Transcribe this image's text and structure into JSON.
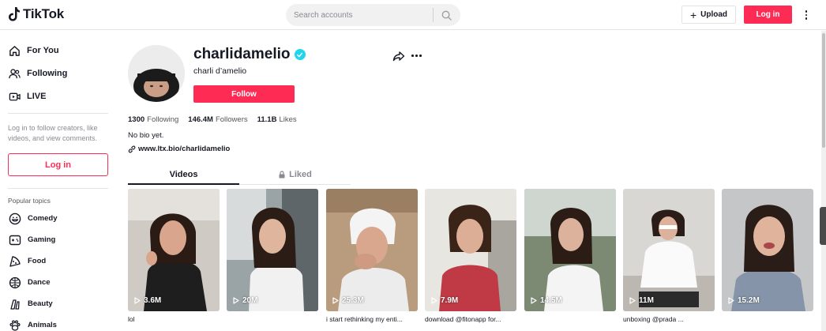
{
  "header": {
    "logo_text": "TikTok",
    "search_placeholder": "Search accounts",
    "upload_label": "Upload",
    "login_label": "Log in"
  },
  "sidebar": {
    "nav": [
      {
        "label": "For You",
        "icon": "home-icon"
      },
      {
        "label": "Following",
        "icon": "following-icon"
      },
      {
        "label": "LIVE",
        "icon": "live-icon"
      }
    ],
    "login_hint": "Log in to follow creators, like videos, and view comments.",
    "login_label": "Log in",
    "popular_title": "Popular topics",
    "topics": [
      {
        "label": "Comedy",
        "icon": "comedy-icon"
      },
      {
        "label": "Gaming",
        "icon": "gaming-icon"
      },
      {
        "label": "Food",
        "icon": "food-icon"
      },
      {
        "label": "Dance",
        "icon": "dance-icon"
      },
      {
        "label": "Beauty",
        "icon": "beauty-icon"
      },
      {
        "label": "Animals",
        "icon": "animals-icon"
      }
    ]
  },
  "profile": {
    "username": "charlidamelio",
    "nickname": "charli d’amelio",
    "follow_label": "Follow",
    "stats": {
      "following_count": "1300",
      "following_label": "Following",
      "followers_count": "146.4M",
      "followers_label": "Followers",
      "likes_count": "11.1B",
      "likes_label": "Likes"
    },
    "bio": "No bio yet.",
    "link": "www.ltx.bio/charlidamelio"
  },
  "tabs": {
    "videos": "Videos",
    "liked": "Liked"
  },
  "videos": [
    {
      "views": "3.6M",
      "caption": "lol"
    },
    {
      "views": "20M",
      "caption": ""
    },
    {
      "views": "25.3M",
      "caption": "i start rethinking my enti..."
    },
    {
      "views": "7.9M",
      "caption": "download @fitonapp for..."
    },
    {
      "views": "14.5M",
      "caption": ""
    },
    {
      "views": "11M",
      "caption": "unboxing @prada ..."
    },
    {
      "views": "15.2M",
      "caption": ""
    }
  ],
  "colors": {
    "accent": "#fe2c55",
    "verified": "#20d5ec",
    "text": "#161823"
  }
}
